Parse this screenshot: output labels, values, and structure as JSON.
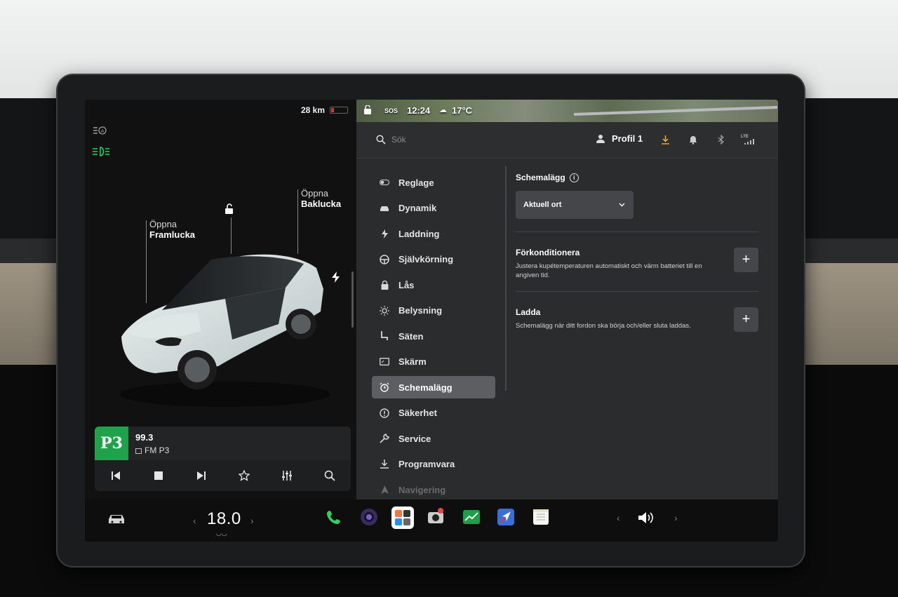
{
  "status": {
    "range": "28 km",
    "sos": "SOS",
    "time": "12:24",
    "temperature": "17°C"
  },
  "vehicle": {
    "front_trunk_line1": "Öppna",
    "front_trunk_line2": "Framlucka",
    "rear_trunk_line1": "Öppna",
    "rear_trunk_line2": "Baklucka"
  },
  "media": {
    "station_logo": "P3",
    "frequency": "99.3",
    "station_name": "FM P3"
  },
  "header": {
    "search_placeholder": "Sök",
    "profile_name": "Profil 1",
    "lte_label": "LTE"
  },
  "menu": {
    "items": [
      {
        "label": "Reglage",
        "icon": "toggle-icon"
      },
      {
        "label": "Dynamik",
        "icon": "car-icon"
      },
      {
        "label": "Laddning",
        "icon": "bolt-icon"
      },
      {
        "label": "Självkörning",
        "icon": "steering-wheel-icon"
      },
      {
        "label": "Lås",
        "icon": "lock-icon"
      },
      {
        "label": "Belysning",
        "icon": "sun-icon"
      },
      {
        "label": "Säten",
        "icon": "seat-icon"
      },
      {
        "label": "Skärm",
        "icon": "display-icon"
      },
      {
        "label": "Schemalägg",
        "icon": "alarm-clock-icon"
      },
      {
        "label": "Säkerhet",
        "icon": "alert-circle-icon"
      },
      {
        "label": "Service",
        "icon": "wrench-icon"
      },
      {
        "label": "Programvara",
        "icon": "download-icon"
      },
      {
        "label": "Navigering",
        "icon": "navigation-icon"
      }
    ],
    "active_index": 8
  },
  "schedule": {
    "title": "Schemalägg",
    "location_value": "Aktuell ort",
    "precondition_title": "Förkonditionera",
    "precondition_desc": "Justera kupétemperaturen automatiskt och värm batteriet till en angiven tid.",
    "charge_title": "Ladda",
    "charge_desc": "Schemalägg när ditt fordon ska börja och/eller sluta laddas."
  },
  "climate": {
    "temperature": "18.0"
  },
  "colors": {
    "accent_green": "#1fd26b",
    "p3_green": "#1fa34a",
    "download_orange": "#f0a030",
    "panel_bg": "#2b2c2e",
    "active_menu_bg": "#5c5e62"
  }
}
